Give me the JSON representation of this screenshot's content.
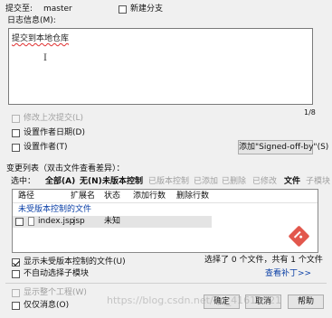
{
  "header": {
    "commit_to_label": "提交至:",
    "branch": "master",
    "new_branch_label": "新建分支"
  },
  "log": {
    "label": "日志信息(M):",
    "message": "提交到本地仓库",
    "char_count": "1/8"
  },
  "options": {
    "amend_label": "修改上次提交(L)",
    "author_date_label": "设置作者日期(D)",
    "author_label": "设置作者(T)",
    "signed_off_button": "添加\"Signed-off-by\"(S)"
  },
  "changes": {
    "header_label": "变更列表（双击文件查看差异）：",
    "select_label": "选中：",
    "filters": [
      {
        "label": "全部(A)",
        "style": "bold"
      },
      {
        "label": "无(N)",
        "style": "bold"
      },
      {
        "label": "未版本控制",
        "style": "bold"
      },
      {
        "label": "已版本控制",
        "style": "dim"
      },
      {
        "label": "已添加",
        "style": "dim"
      },
      {
        "label": "已删除",
        "style": "dim"
      },
      {
        "label": "已修改",
        "style": "dim"
      },
      {
        "label": "文件",
        "style": "bold"
      },
      {
        "label": "子模块",
        "style": "dim"
      }
    ],
    "columns": [
      "路径",
      "扩展名",
      "状态",
      "添加行数",
      "删除行数"
    ],
    "group_label": "未受版本控制的文件",
    "rows": [
      {
        "path": "index.jsp",
        "ext": ".jsp",
        "status": "未知"
      }
    ]
  },
  "footer": {
    "show_unversioned_label": "显示未受版本控制的文件(U)",
    "no_auto_select_label": "不自动选择子模块",
    "selection_status": "选择了 0 个文件，共有 1 个文件",
    "view_patch_link": "查看补丁>>",
    "show_whole_project_label": "显示整个工程(W)",
    "message_only_label": "仅仅消息(O)",
    "ok_button": "确定",
    "cancel_button": "取消",
    "help_button": "帮助"
  },
  "watermark": "https://blog.csdn.net/qq_41613521",
  "colors": {
    "accent_link": "#0a3fa6",
    "git_logo": "#e2574c"
  }
}
